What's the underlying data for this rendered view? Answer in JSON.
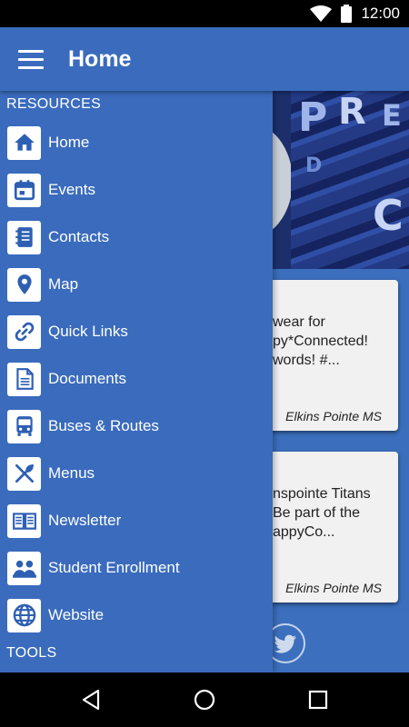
{
  "status_bar": {
    "time": "12:00"
  },
  "header": {
    "title": "Home"
  },
  "drawer": {
    "resources_label": "RESOURCES",
    "tools_label": "TOOLS",
    "items": [
      {
        "label": "Home",
        "icon": "home-icon"
      },
      {
        "label": "Events",
        "icon": "calendar-icon"
      },
      {
        "label": "Contacts",
        "icon": "address-book-icon"
      },
      {
        "label": "Map",
        "icon": "map-pin-icon"
      },
      {
        "label": "Quick Links",
        "icon": "link-icon"
      },
      {
        "label": "Documents",
        "icon": "document-icon"
      },
      {
        "label": "Buses & Routes",
        "icon": "bus-icon"
      },
      {
        "label": "Menus",
        "icon": "utensils-icon"
      },
      {
        "label": "Newsletter",
        "icon": "newsletter-icon"
      },
      {
        "label": "Student Enrollment",
        "icon": "students-icon"
      },
      {
        "label": "Website",
        "icon": "globe-icon"
      }
    ]
  },
  "feed": {
    "cards": [
      {
        "text": "wear for\npy*Connected!\nwords!   #...",
        "source": "Elkins Pointe MS"
      },
      {
        "text": "nspointe Titans\n Be part of the\nappyCo...",
        "source": "Elkins Pointe MS"
      }
    ]
  },
  "colors": {
    "primary": "#3a6bbd",
    "icon_color": "#2d5fb3"
  }
}
